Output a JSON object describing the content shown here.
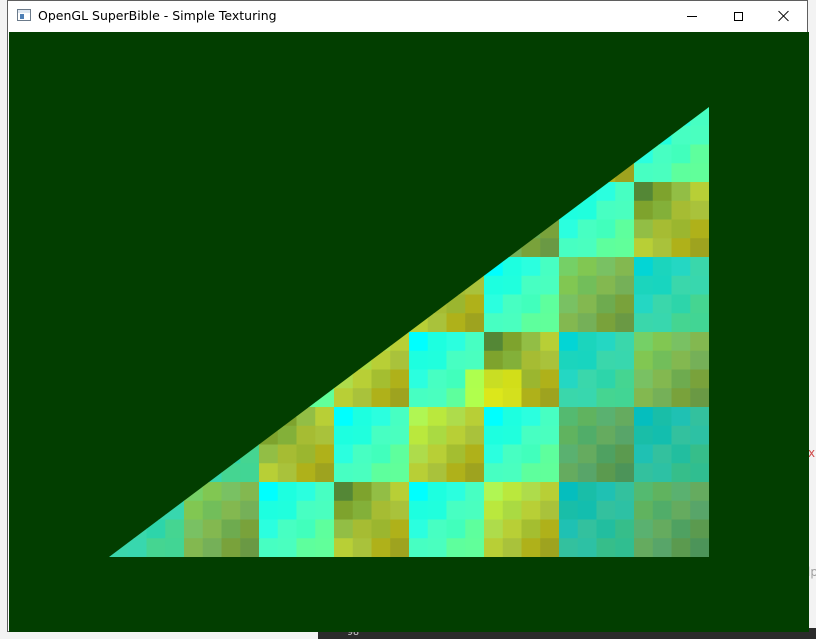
{
  "window": {
    "title": "OpenGL SuperBible - Simple Texturing",
    "icon": "application-window-icon",
    "controls": {
      "minimize": "minimize-icon",
      "maximize": "maximize-icon",
      "close": "close-icon"
    }
  },
  "viewport": {
    "clear_color": "#023e00",
    "shape": "textured right triangle",
    "texture": {
      "palette": [
        "#00ffff",
        "#70ff88",
        "#c2f038",
        "#b8a000",
        "#0a7a7a",
        "#0a0a00",
        "#ffff00"
      ]
    }
  },
  "background": {
    "editor_line_number": "98",
    "edge_fragment_red": "x",
    "edge_fragment_gray": "lp"
  }
}
